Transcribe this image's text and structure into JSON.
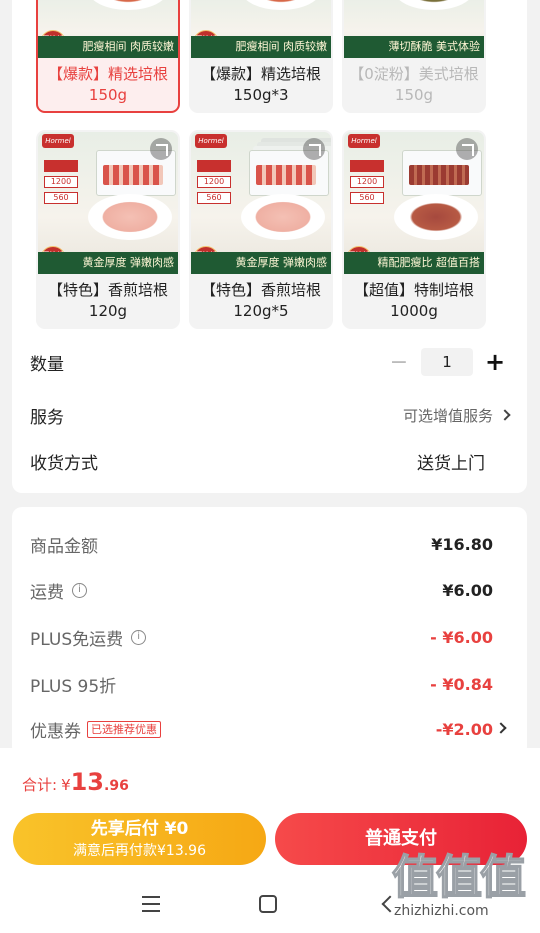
{
  "sku_options": [
    {
      "label": "【爆款】精选培根150g",
      "band": "肥瘦相间 肉质较嫩",
      "selected": true,
      "disabled": false
    },
    {
      "label": "【爆款】精选培根150g*3",
      "band": "肥瘦相间 肉质较嫩",
      "selected": false,
      "disabled": false
    },
    {
      "label": "【0淀粉】美式培根150g",
      "band": "薄切酥脆 美式体验",
      "selected": false,
      "disabled": true
    },
    {
      "label": "【特色】香煎培根120g",
      "band": "黄金厚度 弹嫩肉感",
      "selected": false,
      "disabled": false
    },
    {
      "label": "【特色】香煎培根120g*5",
      "band": "黄金厚度 弹嫩肉感",
      "selected": false,
      "disabled": false
    },
    {
      "label": "【超值】特制培根1000g",
      "band": "精配肥瘦比 超值百搭",
      "selected": false,
      "disabled": false
    }
  ],
  "thumb": {
    "logo": "Hormel",
    "seal": "严控新鲜",
    "stat_1": "1200",
    "stat_2": "560"
  },
  "quantity": {
    "label": "数量",
    "value": "1",
    "minus": "−",
    "plus": "+"
  },
  "service": {
    "label": "服务",
    "value": "可选增值服务"
  },
  "delivery": {
    "label": "收货方式",
    "value": "送货上门"
  },
  "price": {
    "goods_label": "商品金额",
    "goods_value": "¥16.80",
    "shipping_label": "运费",
    "shipping_value": "¥6.00",
    "plus_free_label": "PLUS免运费",
    "plus_free_value": "- ¥6.00",
    "plus_discount_label": "PLUS 95折",
    "plus_discount_value": "- ¥0.84",
    "coupon_label": "优惠券",
    "coupon_tag": "已选推荐优惠",
    "coupon_value": "-¥2.00",
    "info_icon": "i"
  },
  "footer": {
    "total_label": "合计:",
    "currency": "¥",
    "total_int": "13",
    "total_dec": ".96",
    "later_title": "先享后付 ¥0",
    "later_sub": "满意后再付款¥13.96",
    "pay_label": "普通支付"
  },
  "watermark": {
    "big": "值值值",
    "small": "zhizhizhi.com"
  },
  "colors": {
    "accent": "#e8413f",
    "later_button": "#f6a814",
    "pay_button": "#e82236",
    "band_green": "#1f5a33"
  }
}
